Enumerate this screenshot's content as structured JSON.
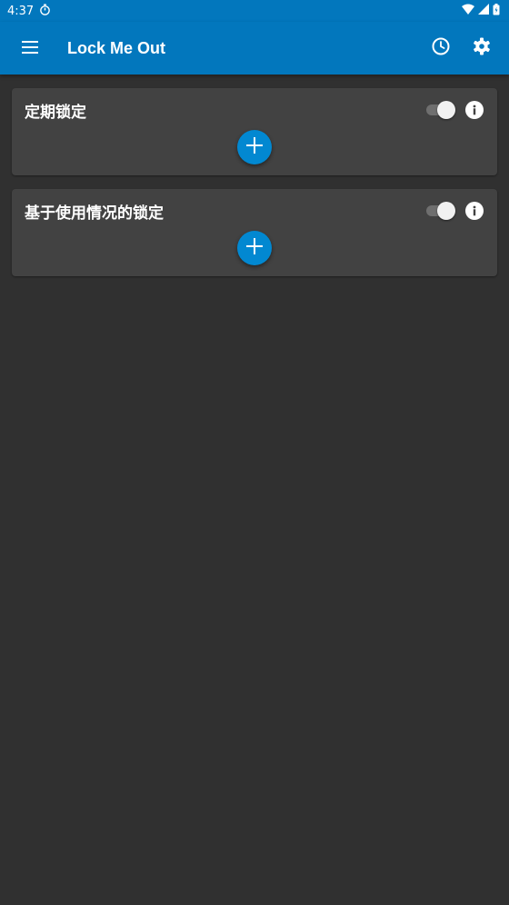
{
  "status_bar": {
    "time": "4:37",
    "icons": [
      "stopwatch-icon",
      "wifi-icon",
      "cell-signal-icon",
      "battery-icon"
    ]
  },
  "app_bar": {
    "title": "Lock Me Out",
    "color": "#0277bd",
    "icons": [
      "menu-icon",
      "history-icon",
      "settings-icon"
    ]
  },
  "cards": [
    {
      "title": "定期锁定",
      "enabled": true
    },
    {
      "title": "基于使用情况的锁定",
      "enabled": true
    }
  ],
  "colors": {
    "background": "#303030",
    "card": "#424242",
    "accent": "#0288d1"
  }
}
